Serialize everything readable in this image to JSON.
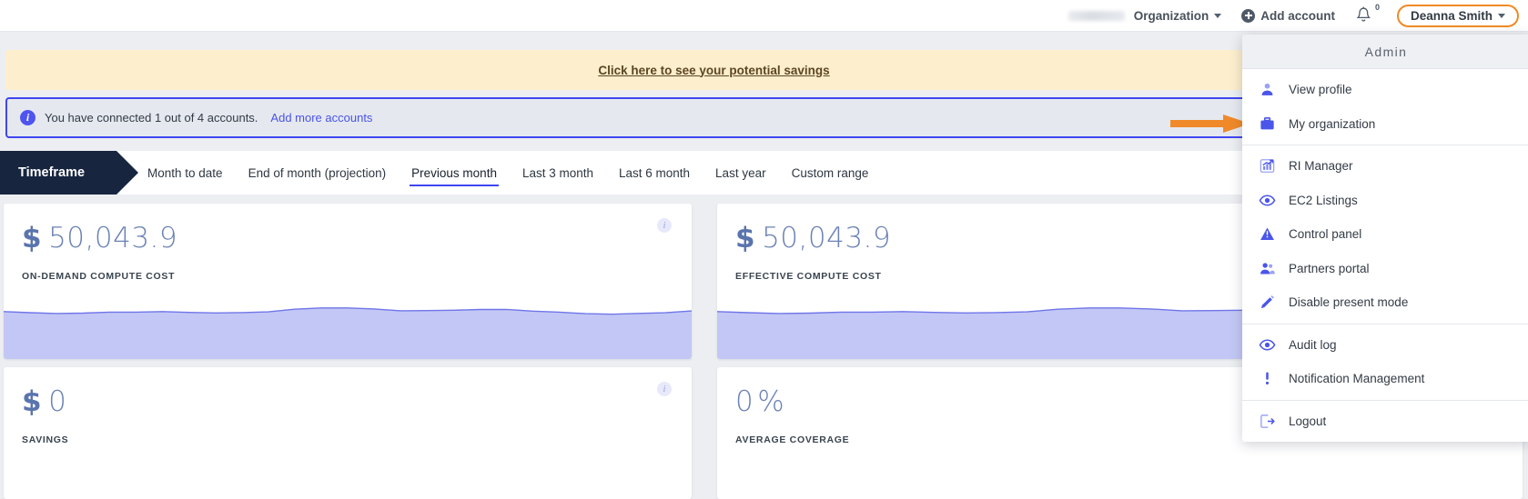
{
  "header": {
    "org_logo_alt": "redacted-logo",
    "org_select_label": "Organization",
    "add_account_label": "Add account",
    "notifications_count": "0",
    "user_name": "Deanna Smith",
    "accent_highlight": "#f08a24"
  },
  "savings_banner": {
    "link_text": "Click here to see your potential savings",
    "bg": "#fdeecd"
  },
  "info_banner": {
    "icon_char": "i",
    "message": "You have connected 1 out of 4 accounts.",
    "link_text": "Add more accounts",
    "border_color": "#3f46f0"
  },
  "timeframe": {
    "chip_label": "Timeframe",
    "tabs": [
      {
        "label": "Month to date",
        "active": false
      },
      {
        "label": "End of month (projection)",
        "active": false
      },
      {
        "label": "Previous month",
        "active": true
      },
      {
        "label": "Last 3 month",
        "active": false
      },
      {
        "label": "Last 6 month",
        "active": false
      },
      {
        "label": "Last year",
        "active": false
      },
      {
        "label": "Custom range",
        "active": false
      }
    ]
  },
  "cards": [
    {
      "currency": "$",
      "value": "50,043.9",
      "suffix": "",
      "label": "ON-DEMAND COMPUTE COST",
      "info": "i"
    },
    {
      "currency": "$",
      "value": "50,043.9",
      "suffix": "",
      "label": "EFFECTIVE COMPUTE COST",
      "info": "i"
    },
    {
      "currency": "$",
      "value": "0",
      "suffix": "",
      "label": "SAVINGS",
      "info": "i"
    },
    {
      "currency": "",
      "value": "0",
      "suffix": "%",
      "label": "AVERAGE COVERAGE",
      "info": "i"
    }
  ],
  "annotation": {
    "arrow_color": "#f08a24",
    "points_to": "My organization"
  },
  "admin_menu": {
    "title": "Admin",
    "groups": [
      {
        "items": [
          {
            "label": "View profile",
            "icon": "person-icon"
          },
          {
            "label": "My organization",
            "icon": "briefcase-icon"
          }
        ]
      },
      {
        "items": [
          {
            "label": "RI Manager",
            "icon": "bar-chart-trend-icon"
          },
          {
            "label": "EC2 Listings",
            "icon": "eye-icon"
          },
          {
            "label": "Control panel",
            "icon": "warning-triangle-icon"
          },
          {
            "label": "Partners portal",
            "icon": "people-group-icon"
          },
          {
            "label": "Disable present mode",
            "icon": "pencil-icon"
          }
        ]
      },
      {
        "items": [
          {
            "label": "Audit log",
            "icon": "eye-icon"
          },
          {
            "label": "Notification Management",
            "icon": "exclamation-icon"
          }
        ]
      },
      {
        "items": [
          {
            "label": "Logout",
            "icon": "logout-icon"
          }
        ]
      }
    ],
    "icon_color": "#4a55ea"
  }
}
